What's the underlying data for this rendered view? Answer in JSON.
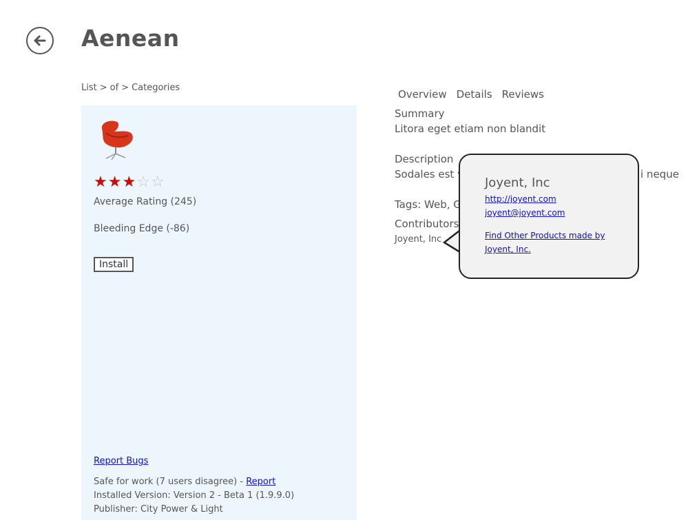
{
  "header": {
    "title": "Aenean"
  },
  "breadcrumb": [
    "List",
    "of",
    "Categories"
  ],
  "breadcrumb_sep": ">",
  "product": {
    "rating_stars": 3,
    "rating_max": 5,
    "average_rating": "Average Rating (245)",
    "bleeding_edge": "Bleeding Edge (-86)",
    "install_label": "Install",
    "report_bugs": "Report Bugs",
    "safe_text": "Safe for work (7 users disagree) - ",
    "report_label": "Report",
    "installed_version": "Installed Version: Version 2 - Beta 1 (1.9.9.0)",
    "publisher": "Publisher: City Power & Light"
  },
  "tabs": [
    "Overview",
    "Details",
    "Reviews"
  ],
  "details": {
    "summary_label": "Summary",
    "summary_text": "Litora eget etiam non blandit",
    "description_label": "Description",
    "description_start": "Sodales est v",
    "description_end": "i neque",
    "tags_text": "Tags: Web, Go",
    "contributors_label": "Contributors",
    "contributor_name": "Joyent, Inc"
  },
  "callout": {
    "title": "Joyent, Inc",
    "website": "http://joyent.com",
    "email": "joyent@joyent.com",
    "find_other": "Find Other Products made by Joyent, Inc."
  },
  "icons": {
    "back": "back-arrow-icon",
    "product_image": "red-swivel-chair-image"
  },
  "colors": {
    "panel_bg": "#eef6fd",
    "star_filled": "#cc0a0a",
    "star_empty": "#c4c4c4",
    "link": "#1010cc",
    "callout_bg": "#f2f2f2"
  }
}
